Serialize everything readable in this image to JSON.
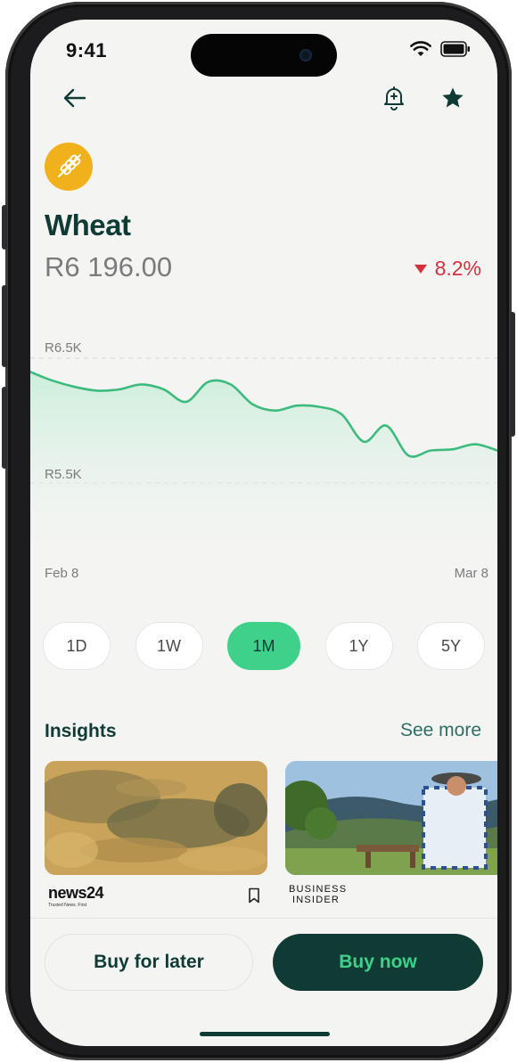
{
  "status_bar": {
    "time": "9:41"
  },
  "commodity": {
    "name": "Wheat",
    "price": "R6 196.00",
    "change": "8.2%",
    "change_direction": "down",
    "icon": "wheat-icon"
  },
  "chart_data": {
    "type": "area",
    "y_tick_labels": [
      "R6.5K",
      "R5.5K"
    ],
    "x_tick_labels": [
      "Feb 8",
      "Mar 8"
    ],
    "ylim": [
      5500,
      6500
    ],
    "values": [
      6390,
      6320,
      6270,
      6240,
      6250,
      6290,
      6250,
      6150,
      6310,
      6290,
      6130,
      6080,
      6120,
      6110,
      6050,
      5830,
      5960,
      5720,
      5760,
      5770,
      5810,
      5760
    ],
    "line_color": "#3dbb7e",
    "fill_color": "#c8efd9",
    "grid": "dashed"
  },
  "ranges": {
    "items": [
      "1D",
      "1W",
      "1M",
      "1Y",
      "5Y"
    ],
    "active": "1M"
  },
  "insights": {
    "title": "Insights",
    "see_more": "See more",
    "cards": [
      {
        "source_logo": "news24",
        "source_tagline": "Trusted News. First"
      },
      {
        "source_logo_line1": "BUSINESS",
        "source_logo_line2": "INSIDER"
      }
    ]
  },
  "actions": {
    "buy_later": "Buy for later",
    "buy_now": "Buy now"
  },
  "colors": {
    "brand_dark": "#0f3b34",
    "accent_green": "#3fd18a",
    "negative": "#d6313f",
    "badge_yellow": "#f0b11a"
  }
}
